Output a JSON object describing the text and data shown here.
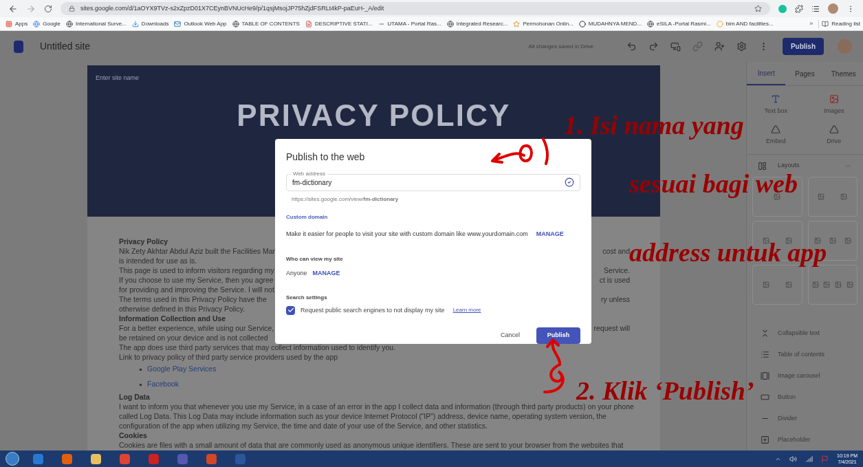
{
  "browser": {
    "url": "sites.google.com/d/1aOYX9TVz-s2xZpzD01X7CEynBVNUcHe9/p/1qsjMsojJP75hZjdFSRLt4kP-paEuH-_A/edit",
    "bookmarks": [
      "Apps",
      "Google",
      "International Surve...",
      "Downloads",
      "Outlook Web App",
      "TABLE OF CONTENTS",
      "DESCRIPTIVE STATI...",
      "UTAMA - Portal Ras...",
      "Integrated Researc...",
      "Permohonan Onlin...",
      "MUDAHNYA MEND...",
      "eSILA -Portal Rasmi...",
      "bim AND facilities..."
    ],
    "more": "»",
    "reading_list": "Reading list"
  },
  "app_header": {
    "title": "Untitled site",
    "status": "All changes saved in Drive",
    "publish": "Publish"
  },
  "canvas": {
    "site_name_placeholder": "Enter site name",
    "hero_title": "PRIVACY POLICY",
    "lines": [
      {
        "kind": "heading",
        "left": "Privacy Policy"
      },
      {
        "kind": "text",
        "left": "Nik Zety Akhtar Abdul Aziz built the Facilities Mar",
        "right": "cost and"
      },
      {
        "kind": "text",
        "left": "is intended for use as is."
      },
      {
        "kind": "text",
        "left": "This page is used to inform visitors regarding my",
        "right": "Service."
      },
      {
        "kind": "text",
        "left": "If you choose to use my Service, then you agree",
        "right": "ct is used"
      },
      {
        "kind": "text",
        "left": "for providing and improving the Service. I will not"
      },
      {
        "kind": "text",
        "left": "The terms used in this Privacy Policy have the",
        "right": "ry unless"
      },
      {
        "kind": "text",
        "left": "otherwise defined in this Privacy Policy."
      },
      {
        "kind": "heading",
        "left": "Information Collection and Use"
      },
      {
        "kind": "text",
        "left": "For a better experience, while using our Service,",
        "right": "request will"
      },
      {
        "kind": "text",
        "left": "be retained on your device and is not collected"
      },
      {
        "kind": "text",
        "left": "The app does use third party services that may collect information used to identify you."
      },
      {
        "kind": "text",
        "left": "Link to privacy policy of third party service providers used by the app"
      },
      {
        "kind": "link",
        "left": "Google Play Services"
      },
      {
        "kind": "link",
        "left": "Facebook"
      },
      {
        "kind": "heading",
        "left": "Log Data"
      },
      {
        "kind": "text",
        "left": "I want to inform you that whenever you use my Service, in a case of an error in the app I collect data and information (through third party products) on your phone"
      },
      {
        "kind": "text",
        "left": "called Log Data. This Log Data may include information such as your device Internet Protocol (“IP”) address, device name, operating system version, the"
      },
      {
        "kind": "text",
        "left": "configuration of the app when utilizing my Service, the time and date of your use of the Service, and other statistics."
      },
      {
        "kind": "heading",
        "left": "Cookies"
      },
      {
        "kind": "text",
        "left": "Cookies are files with a small amount of data that are commonly used as anonymous unique identifiers. These are sent to your browser from the websites that"
      }
    ]
  },
  "sidebar": {
    "tabs": [
      {
        "label": "Insert",
        "selected": true
      },
      {
        "label": "Pages",
        "selected": false
      },
      {
        "label": "Themes",
        "selected": false
      }
    ],
    "blocks": [
      "Text box",
      "Images",
      "Embed",
      "Drive"
    ],
    "layouts": "Layouts",
    "items": [
      "Collapsible text",
      "Table of contents",
      "Image carousel",
      "Button",
      "Divider",
      "Placeholder"
    ]
  },
  "dialog": {
    "title": "Publish to the web",
    "field_label": "Web address",
    "field_value": "fm-dictionary",
    "url_hint": "https://sites.google.com/view/**fm-dictionary**",
    "custom_domain": "Custom domain",
    "custom_domain_text": "Make it easier for people to visit your site with custom domain like www.yourdomain.com",
    "manage": "MANAGE",
    "who_label": "Who can view my site",
    "who_value": "Anyone",
    "who_manage": "MANAGE",
    "search_label": "Search settings",
    "search_option": {
      "label": "Request public search engines to not display my site",
      "checked": true
    },
    "learn_more": "Learn more",
    "cancel": "Cancel",
    "publish": "Publish"
  },
  "annotations": [
    "1. Isi nama yang",
    "sesuai bagi web",
    "address untuk app",
    "2. Klik ‘Publish’"
  ],
  "taskbar": {
    "time": "10:19 PM",
    "date": "7/4/2021"
  }
}
